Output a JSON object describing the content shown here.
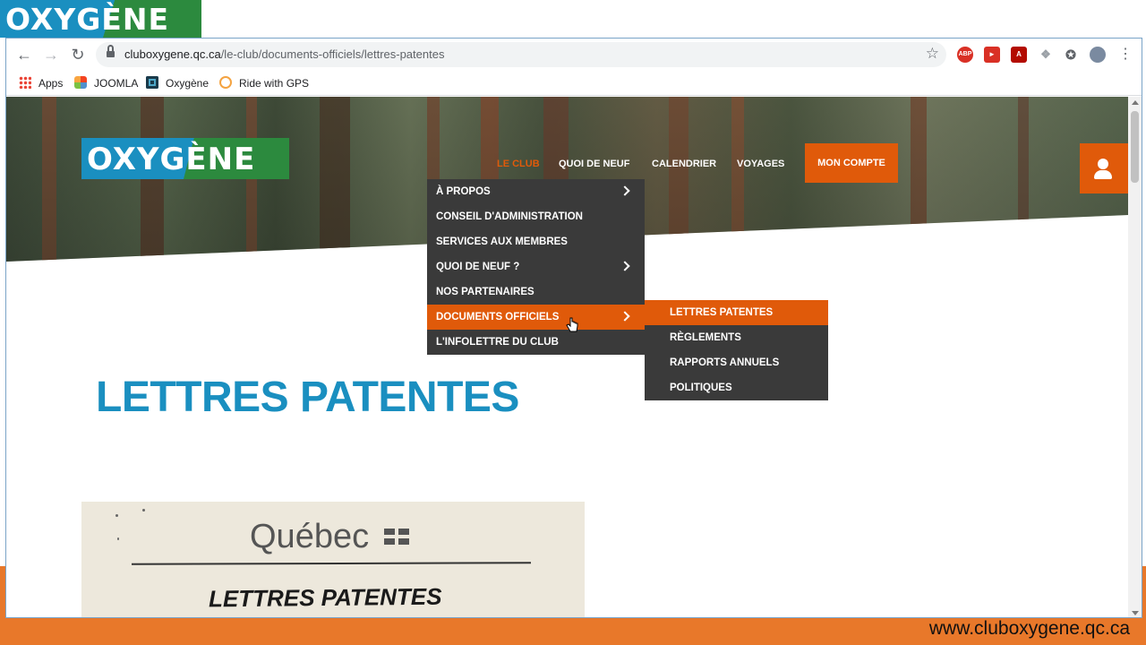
{
  "overlay": {
    "logo_text": "OXYGÈNE",
    "caption": "www.cluboxygene.qc.ca"
  },
  "browser": {
    "url_domain": "cluboxygene.qc.ca",
    "url_path": "/le-club/documents-officiels/lettres-patentes",
    "bookmarks": [
      "Apps",
      "JOOMLA",
      "Oxygène",
      "Ride with GPS"
    ]
  },
  "site": {
    "logo_text": "OXYGÈNE",
    "nav": [
      "LE CLUB",
      "QUOI DE NEUF",
      "CALENDRIER",
      "VOYAGES"
    ],
    "account_label": "MON COMPTE",
    "menu": [
      {
        "label": "À PROPOS",
        "has_sub": true
      },
      {
        "label": "CONSEIL D'ADMINISTRATION",
        "has_sub": false
      },
      {
        "label": "SERVICES AUX MEMBRES",
        "has_sub": false
      },
      {
        "label": "QUOI DE NEUF ?",
        "has_sub": true
      },
      {
        "label": "NOS PARTENAIRES",
        "has_sub": false
      },
      {
        "label": "DOCUMENTS OFFICIELS",
        "has_sub": true,
        "active": true
      },
      {
        "label": "L'INFOLETTRE DU CLUB",
        "has_sub": false
      }
    ],
    "submenu": [
      "LETTRES PATENTES",
      "RÈGLEMENTS",
      "RAPPORTS ANNUELS",
      "POLITIQUES"
    ],
    "page_title": "LETTRES PATENTES",
    "document": {
      "header": "Québec",
      "title": "LETTRES PATENTES"
    }
  },
  "colors": {
    "accent_orange": "#e05a0a",
    "brand_blue": "#1a8fc0",
    "brand_green": "#2c8a3e",
    "menu_bg": "#3a3a3a",
    "frame_orange": "#e8782a"
  }
}
